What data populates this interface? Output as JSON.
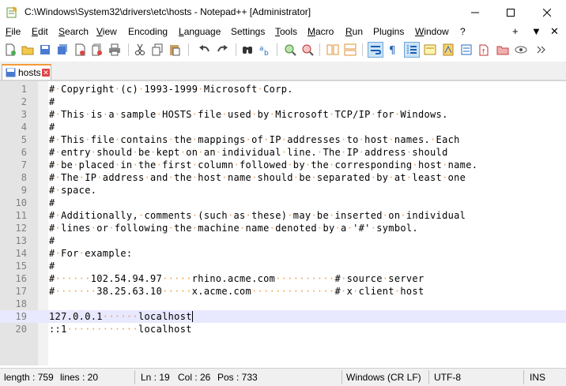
{
  "window": {
    "title": "C:\\Windows\\System32\\drivers\\etc\\hosts - Notepad++ [Administrator]"
  },
  "menu": {
    "items": [
      {
        "key": "F",
        "rest": "ile"
      },
      {
        "key": "E",
        "rest": "dit"
      },
      {
        "key": "S",
        "rest": "earch"
      },
      {
        "key": "V",
        "rest": "iew"
      },
      {
        "key": "",
        "rest": "Encoding"
      },
      {
        "key": "L",
        "rest": "anguage"
      },
      {
        "key": "",
        "rest": "Settings"
      },
      {
        "key": "T",
        "rest": "ools"
      },
      {
        "key": "M",
        "rest": "acro"
      },
      {
        "key": "R",
        "rest": "un"
      },
      {
        "key": "",
        "rest": "Plugins"
      },
      {
        "key": "W",
        "rest": "indow"
      },
      {
        "key": "",
        "rest": "?"
      }
    ],
    "right": [
      "+",
      "▼",
      "✕"
    ]
  },
  "tab": {
    "label": "hosts"
  },
  "editor": {
    "lines": [
      "#·Copyright·(c)·1993-1999·Microsoft·Corp.",
      "#",
      "#·This·is·a·sample·HOSTS·file·used·by·Microsoft·TCP/IP·for·Windows.",
      "#",
      "#·This·file·contains·the·mappings·of·IP·addresses·to·host·names.·Each",
      "#·entry·should·be·kept·on·an·individual·line.·The·IP·address·should",
      "#·be·placed·in·the·first·column·followed·by·the·corresponding·host·name.",
      "#·The·IP·address·and·the·host·name·should·be·separated·by·at·least·one",
      "#·space.",
      "#",
      "#·Additionally,·comments·(such·as·these)·may·be·inserted·on·individual",
      "#·lines·or·following·the·machine·name·denoted·by·a·'#'·symbol.",
      "#",
      "#·For·example:",
      "#",
      "#······102.54.94.97·····rhino.acme.com··········#·source·server",
      "#·······38.25.63.10·····x.acme.com··············#·x·client·host",
      "",
      "127.0.0.1······localhost",
      "::1············localhost"
    ],
    "current_line": 19
  },
  "status": {
    "length": "length : 759",
    "lines": "lines : 20",
    "ln": "Ln : 19",
    "col": "Col : 26",
    "pos": "Pos : 733",
    "eol": "Windows (CR LF)",
    "encoding": "UTF-8",
    "mode": "INS"
  }
}
